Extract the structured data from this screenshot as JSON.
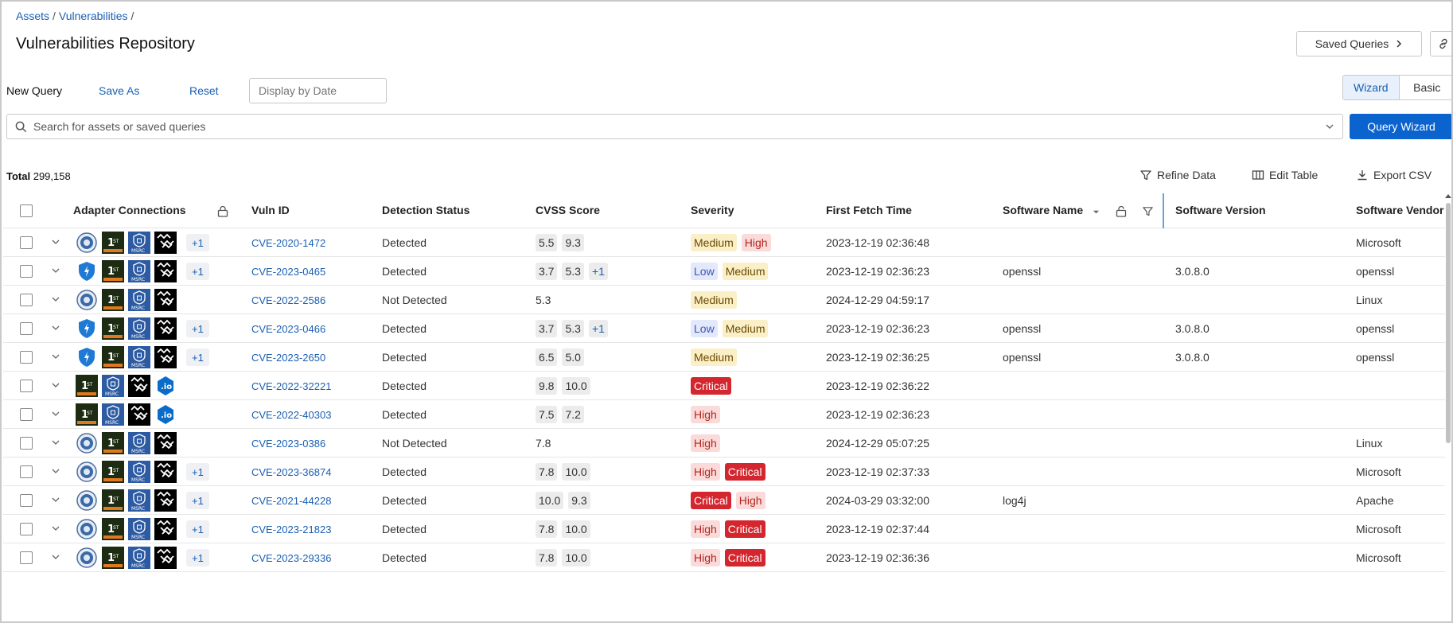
{
  "breadcrumb": [
    "Assets",
    "Vulnerabilities"
  ],
  "breadcrumb_sep": "/",
  "page_title": "Vulnerabilities Repository",
  "saved_queries_label": "Saved Queries",
  "query": {
    "new_query": "New Query",
    "save_as": "Save As",
    "reset": "Reset",
    "date_placeholder": "Display by Date"
  },
  "mode_toggle": {
    "wizard": "Wizard",
    "basic": "Basic",
    "active": "Wizard"
  },
  "search": {
    "placeholder": "Search for assets or saved queries"
  },
  "query_wizard_label": "Query Wizard",
  "total": {
    "label": "Total",
    "value": "299,158"
  },
  "actions": {
    "refine": "Refine Data",
    "edit": "Edit Table",
    "export": "Export CSV"
  },
  "columns": {
    "adapters": "Adapter Connections",
    "vuln_id": "Vuln ID",
    "detection": "Detection Status",
    "cvss": "CVSS Score",
    "severity": "Severity",
    "first_fetch": "First Fetch Time",
    "software_name": "Software Name",
    "software_version": "Software Version",
    "software_vendor": "Software Vendor"
  },
  "colors": {
    "accent": "#0b63ce",
    "link": "#1a5fb4",
    "critical": "#d4262e",
    "high": "#fbdada",
    "medium": "#fbefc8",
    "low": "#e3e8fb"
  },
  "rows": [
    {
      "adapters": [
        "seal",
        "ops",
        "msrc",
        "link"
      ],
      "more": "+1",
      "vuln_id": "CVE-2020-1472",
      "detection": "Detected",
      "cvss": [
        "5.5",
        "9.3"
      ],
      "cvss_more": "",
      "severity": [
        "Medium",
        "High"
      ],
      "first_fetch": "2023-12-19 02:36:48",
      "software_name": "",
      "software_version": "",
      "software_vendor": "Microsoft"
    },
    {
      "adapters": [
        "shield",
        "ops",
        "msrc",
        "link"
      ],
      "more": "+1",
      "vuln_id": "CVE-2023-0465",
      "detection": "Detected",
      "cvss": [
        "3.7",
        "5.3"
      ],
      "cvss_more": "+1",
      "severity": [
        "Low",
        "Medium"
      ],
      "first_fetch": "2023-12-19 02:36:23",
      "software_name": "openssl",
      "software_version": "3.0.8.0",
      "software_vendor": "openssl"
    },
    {
      "adapters": [
        "seal",
        "ops",
        "msrc",
        "link"
      ],
      "more": "",
      "vuln_id": "CVE-2022-2586",
      "detection": "Not Detected",
      "cvss": [
        "5.3"
      ],
      "cvss_plain": true,
      "cvss_more": "",
      "severity": [
        "Medium"
      ],
      "first_fetch": "2024-12-29 04:59:17",
      "software_name": "",
      "software_version": "",
      "software_vendor": "Linux"
    },
    {
      "adapters": [
        "shield",
        "ops",
        "msrc",
        "link"
      ],
      "more": "+1",
      "vuln_id": "CVE-2023-0466",
      "detection": "Detected",
      "cvss": [
        "3.7",
        "5.3"
      ],
      "cvss_more": "+1",
      "severity": [
        "Low",
        "Medium"
      ],
      "first_fetch": "2023-12-19 02:36:23",
      "software_name": "openssl",
      "software_version": "3.0.8.0",
      "software_vendor": "openssl"
    },
    {
      "adapters": [
        "shield",
        "ops",
        "msrc",
        "link"
      ],
      "more": "+1",
      "vuln_id": "CVE-2023-2650",
      "detection": "Detected",
      "cvss": [
        "6.5",
        "5.0"
      ],
      "cvss_more": "",
      "severity": [
        "Medium"
      ],
      "first_fetch": "2023-12-19 02:36:25",
      "software_name": "openssl",
      "software_version": "3.0.8.0",
      "software_vendor": "openssl"
    },
    {
      "adapters": [
        "ops",
        "msrc",
        "link",
        "io"
      ],
      "more": "",
      "vuln_id": "CVE-2022-32221",
      "detection": "Detected",
      "cvss": [
        "9.8",
        "10.0"
      ],
      "cvss_more": "",
      "severity": [
        "Critical"
      ],
      "first_fetch": "2023-12-19 02:36:22",
      "software_name": "",
      "software_version": "",
      "software_vendor": ""
    },
    {
      "adapters": [
        "ops",
        "msrc",
        "link",
        "io"
      ],
      "more": "",
      "vuln_id": "CVE-2022-40303",
      "detection": "Detected",
      "cvss": [
        "7.5",
        "7.2"
      ],
      "cvss_more": "",
      "severity": [
        "High"
      ],
      "first_fetch": "2023-12-19 02:36:23",
      "software_name": "",
      "software_version": "",
      "software_vendor": ""
    },
    {
      "adapters": [
        "seal",
        "ops",
        "msrc",
        "link"
      ],
      "more": "",
      "vuln_id": "CVE-2023-0386",
      "detection": "Not Detected",
      "cvss": [
        "7.8"
      ],
      "cvss_plain": true,
      "cvss_more": "",
      "severity": [
        "High"
      ],
      "first_fetch": "2024-12-29 05:07:25",
      "software_name": "",
      "software_version": "",
      "software_vendor": "Linux"
    },
    {
      "adapters": [
        "seal",
        "ops",
        "msrc",
        "link"
      ],
      "more": "+1",
      "vuln_id": "CVE-2023-36874",
      "detection": "Detected",
      "cvss": [
        "7.8",
        "10.0"
      ],
      "cvss_more": "",
      "severity": [
        "High",
        "Critical"
      ],
      "first_fetch": "2023-12-19 02:37:33",
      "software_name": "",
      "software_version": "",
      "software_vendor": "Microsoft"
    },
    {
      "adapters": [
        "seal",
        "ops",
        "msrc",
        "link"
      ],
      "more": "+1",
      "vuln_id": "CVE-2021-44228",
      "detection": "Detected",
      "cvss": [
        "10.0",
        "9.3"
      ],
      "cvss_more": "",
      "severity": [
        "Critical",
        "High"
      ],
      "first_fetch": "2024-03-29 03:32:00",
      "software_name": "log4j",
      "software_version": "",
      "software_vendor": "Apache"
    },
    {
      "adapters": [
        "seal",
        "ops",
        "msrc",
        "link"
      ],
      "more": "+1",
      "vuln_id": "CVE-2023-21823",
      "detection": "Detected",
      "cvss": [
        "7.8",
        "10.0"
      ],
      "cvss_more": "",
      "severity": [
        "High",
        "Critical"
      ],
      "first_fetch": "2023-12-19 02:37:44",
      "software_name": "",
      "software_version": "",
      "software_vendor": "Microsoft"
    },
    {
      "adapters": [
        "seal",
        "ops",
        "msrc",
        "link"
      ],
      "more": "+1",
      "vuln_id": "CVE-2023-29336",
      "detection": "Detected",
      "cvss": [
        "7.8",
        "10.0"
      ],
      "cvss_more": "",
      "severity": [
        "High",
        "Critical"
      ],
      "first_fetch": "2023-12-19 02:36:36",
      "software_name": "",
      "software_version": "",
      "software_vendor": "Microsoft"
    }
  ]
}
